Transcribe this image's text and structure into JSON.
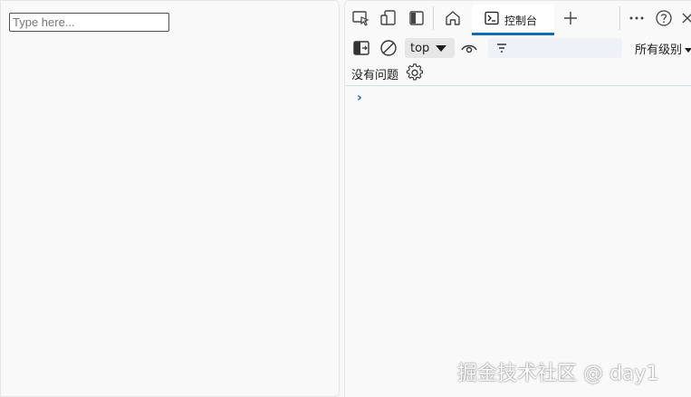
{
  "left_page": {
    "input_placeholder": "Type here..."
  },
  "devtools": {
    "tabs": [
      {
        "label": "",
        "icon": "home-icon"
      },
      {
        "label": "控制台",
        "icon": "console-icon",
        "active": true
      }
    ],
    "toolbar": {
      "context": "top",
      "filter_placeholder": "",
      "levels": "所有级别"
    },
    "issues": {
      "label": "没有问题"
    },
    "prompt": "›",
    "accent_color": "#0f6cbd"
  },
  "watermark": "掘金技术社区 @ day1"
}
